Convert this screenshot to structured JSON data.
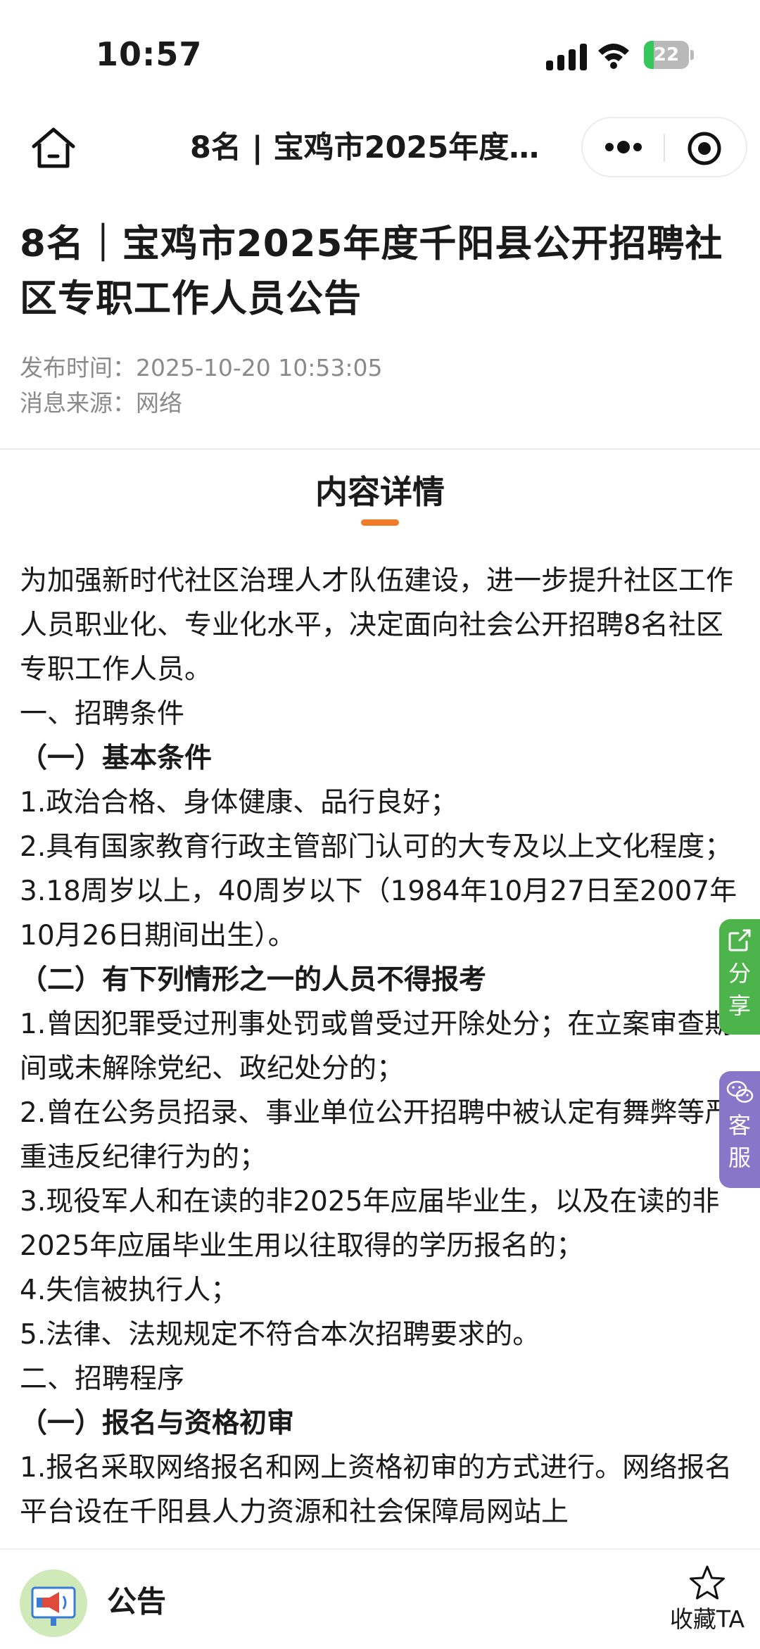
{
  "status_bar": {
    "time": "10:57",
    "battery": "22",
    "battery_level_percent": 22
  },
  "nav": {
    "title": "8名 | 宝鸡市2025年度…",
    "icons": [
      "home-icon",
      "more-icon",
      "close-target-icon"
    ]
  },
  "article": {
    "title": "8名｜宝鸡市2025年度千阳县公开招聘社区专职工作人员公告",
    "publish_time": "发布时间：2025-10-20 10:53:05",
    "source": "消息来源：网络"
  },
  "section": {
    "heading": "内容详情",
    "accent_color": "#f07b2b"
  },
  "content": [
    {
      "text": "为加强新时代社区治理人才队伍建设，进一步提升社区工作人员职业化、专业化水平，决定面向社会公开招聘8名社区专职工作人员。",
      "bold": false
    },
    {
      "text": "一、招聘条件",
      "bold": false
    },
    {
      "text": "（一）基本条件",
      "bold": true
    },
    {
      "text": "1.政治合格、身体健康、品行良好；",
      "bold": false
    },
    {
      "text": "2.具有国家教育行政主管部门认可的大专及以上文化程度；",
      "bold": false
    },
    {
      "text": "3.18周岁以上，40周岁以下（1984年10月27日至2007年10月26日期间出生）。",
      "bold": false
    },
    {
      "text": "（二）有下列情形之一的人员不得报考",
      "bold": true
    },
    {
      "text": "1.曾因犯罪受过刑事处罚或曾受过开除处分；在立案审查期间或未解除党纪、政纪处分的；",
      "bold": false
    },
    {
      "text": "2.曾在公务员招录、事业单位公开招聘中被认定有舞弊等严重违反纪律行为的；",
      "bold": false
    },
    {
      "text": "3.现役军人和在读的非2025年应届毕业生，以及在读的非2025年应届毕业生用以往取得的学历报名的；",
      "bold": false
    },
    {
      "text": "4.失信被执行人；",
      "bold": false
    },
    {
      "text": "5.法律、法规规定不符合本次招聘要求的。",
      "bold": false
    },
    {
      "text": "二、招聘程序",
      "bold": false
    },
    {
      "text": "（一）报名与资格初审",
      "bold": true
    },
    {
      "text": "1.报名采取网络报名和网上资格初审的方式进行。网络报名平台设在千阳县人力资源和社会保障局网站上",
      "bold": false
    }
  ],
  "floating": {
    "share": {
      "chars": [
        "分",
        "享"
      ],
      "color": "#4cb44a",
      "icon": "share-icon"
    },
    "service": {
      "chars": [
        "客",
        "服"
      ],
      "color": "#8877c8",
      "icon": "wechat-icon"
    }
  },
  "bottom_bar": {
    "name": "公告",
    "favorite_label": "收藏TA",
    "logo_icon": "megaphone-icon",
    "favorite_icon": "star-icon"
  }
}
